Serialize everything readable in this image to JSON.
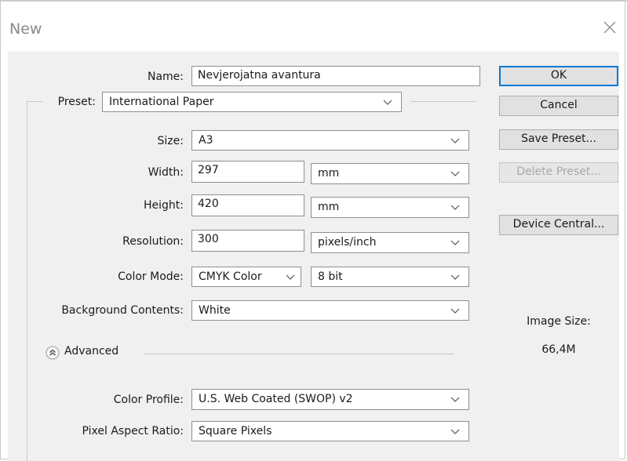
{
  "dialog": {
    "title": "New"
  },
  "form": {
    "name_label": "Name:",
    "name_value": "Nevjerojatna avantura",
    "preset_label": "Preset:",
    "preset_value": "International Paper",
    "size_label": "Size:",
    "size_value": "A3",
    "width_label": "Width:",
    "width_value": "297",
    "width_unit": "mm",
    "height_label": "Height:",
    "height_value": "420",
    "height_unit": "mm",
    "resolution_label": "Resolution:",
    "resolution_value": "300",
    "resolution_unit": "pixels/inch",
    "color_mode_label": "Color Mode:",
    "color_mode_value": "CMYK Color",
    "bit_depth_value": "8 bit",
    "background_label": "Background Contents:",
    "background_value": "White",
    "advanced_label": "Advanced",
    "color_profile_label": "Color Profile:",
    "color_profile_value": "U.S. Web Coated (SWOP) v2",
    "pixel_aspect_label": "Pixel Aspect Ratio:",
    "pixel_aspect_value": "Square Pixels"
  },
  "buttons": {
    "ok": "OK",
    "cancel": "Cancel",
    "save_preset": "Save Preset...",
    "delete_preset": "Delete Preset...",
    "device_central": "Device Central..."
  },
  "info": {
    "image_size_label": "Image Size:",
    "image_size_value": "66,4M"
  },
  "colors": {
    "accent": "#0078d7",
    "panel": "#f0f0f0",
    "disabled_text": "#a8a8a8"
  },
  "icons": [
    "close-icon",
    "chevron-down-icon",
    "chevron-up-circle-icon"
  ]
}
